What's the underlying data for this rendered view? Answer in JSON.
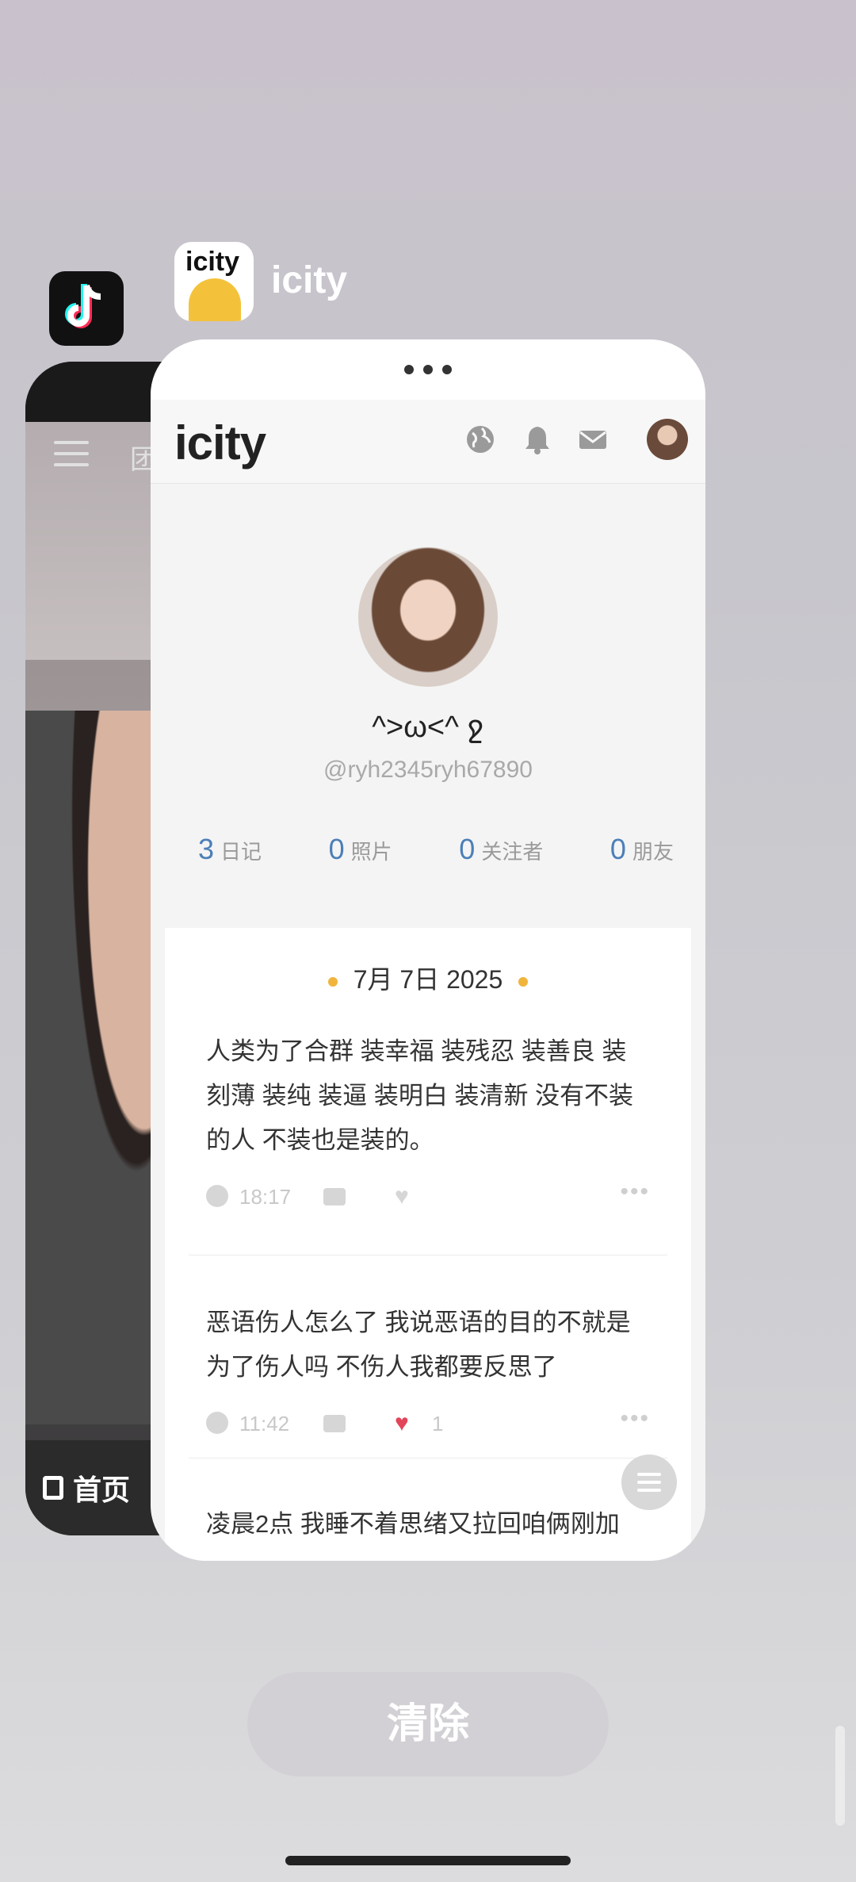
{
  "tiktok": {
    "label_partial": "团",
    "home_label": "首页"
  },
  "app": {
    "icon_text": "icity",
    "name": "icity"
  },
  "icity": {
    "logo": "icity",
    "profile": {
      "nickname": "^>ω<^ ջ",
      "handle": "@ryh2345ryh67890"
    },
    "stats": [
      {
        "value": "3",
        "label": "日记"
      },
      {
        "value": "0",
        "label": "照片"
      },
      {
        "value": "0",
        "label": "关注者"
      },
      {
        "value": "0",
        "label": "朋友"
      }
    ],
    "date": "7月 7日 2025",
    "posts": [
      {
        "text": "人类为了合群 装幸福 装残忍 装善良 装刻薄 装纯 装逼 装明白 装清新 没有不装的人 不装也是装的。",
        "time": "18:17",
        "likes": ""
      },
      {
        "text": "恶语伤人怎么了 我说恶语的目的不就是为了伤人吗 不伤人我都要反思了",
        "time": "11:42",
        "likes": "1"
      },
      {
        "text": "凌晨2点 我睡不着思绪又拉回咱俩刚加",
        "time": "",
        "likes": ""
      }
    ]
  },
  "clear_button": "清除",
  "colors": {
    "accent_blue": "#4c7fb8",
    "date_dot": "#f0b43c",
    "liked_heart": "#e2465a"
  }
}
